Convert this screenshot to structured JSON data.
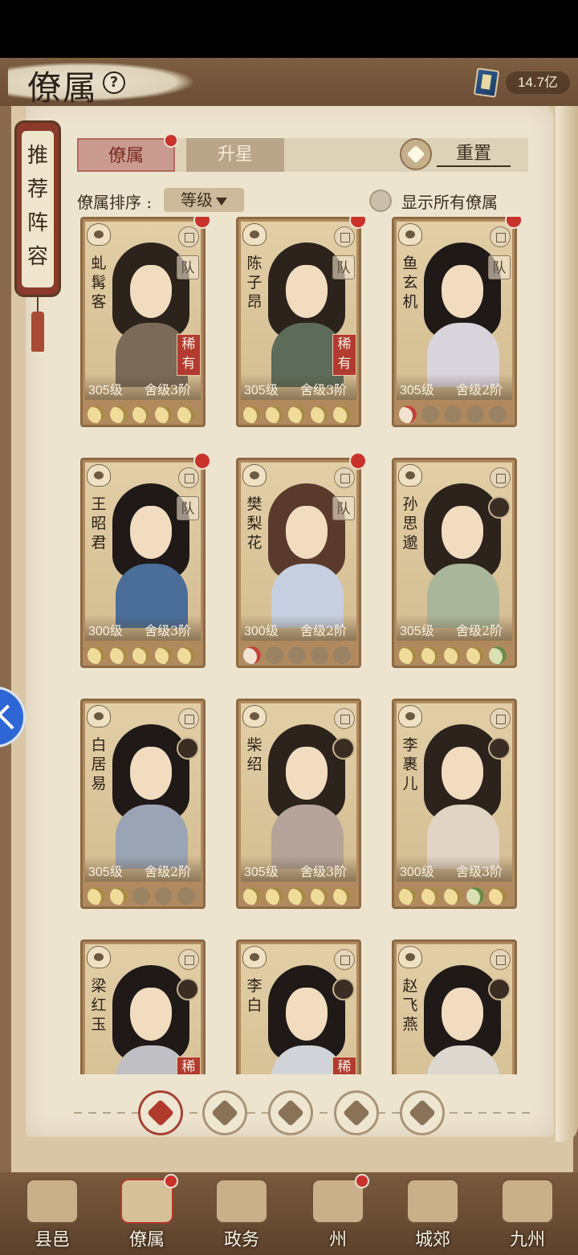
{
  "header": {
    "title": "僚属",
    "currency_value": "14.7亿"
  },
  "recommend": {
    "label": "推荐阵容"
  },
  "tabs": [
    {
      "label": "僚属"
    },
    {
      "label": "升星"
    }
  ],
  "reset": {
    "label": "重置"
  },
  "sort": {
    "label": "僚属排序 :",
    "value": "等级"
  },
  "show_all": {
    "label": "显示所有僚属"
  },
  "cards": [
    {
      "name": "虬髯客",
      "level": "305级",
      "rank": "舍级3阶",
      "rarity": "稀有",
      "team": "队",
      "stars": [
        "lit",
        "lit",
        "lit",
        "lit",
        "lit"
      ],
      "robe": "#7a6a58",
      "hair": "#2b231c"
    },
    {
      "name": "陈子昂",
      "level": "305级",
      "rank": "舍级3阶",
      "rarity": "稀有",
      "team": "队",
      "stars": [
        "lit",
        "lit",
        "lit",
        "lit",
        "lit"
      ],
      "robe": "#5d6b5a",
      "hair": "#2b231c"
    },
    {
      "name": "鱼玄机",
      "level": "305级",
      "rank": "舍级2阶",
      "rarity": "",
      "team": "队",
      "stars": [
        "red",
        "dim",
        "dim",
        "dim",
        "dim"
      ],
      "robe": "#d8d4dc",
      "hair": "#1f1a18"
    },
    {
      "name": "王昭君",
      "level": "300级",
      "rank": "舍级3阶",
      "rarity": "",
      "team": "队",
      "stars": [
        "lit",
        "lit",
        "lit",
        "lit",
        "lit"
      ],
      "robe": "#4a6e98",
      "hair": "#1f1a18"
    },
    {
      "name": "樊梨花",
      "level": "300级",
      "rank": "舍级2阶",
      "rarity": "",
      "team": "队",
      "stars": [
        "red",
        "dim",
        "dim",
        "dim",
        "dim"
      ],
      "robe": "#c6cfe0",
      "hair": "#5a3a2c"
    },
    {
      "name": "孙思邈",
      "level": "305级",
      "rank": "舍级2阶",
      "rarity": "",
      "team": "",
      "stars": [
        "lit",
        "lit",
        "lit",
        "lit",
        "green"
      ],
      "robe": "#aab69a",
      "hair": "#2b231c"
    },
    {
      "name": "白居易",
      "level": "305级",
      "rank": "舍级2阶",
      "rarity": "",
      "team": "",
      "stars": [
        "lit",
        "lit",
        "dim",
        "dim",
        "dim"
      ],
      "robe": "#9aa4b4",
      "hair": "#1f1a18"
    },
    {
      "name": "柴绍",
      "level": "305级",
      "rank": "舍级3阶",
      "rarity": "",
      "team": "",
      "stars": [
        "lit",
        "lit",
        "lit",
        "lit",
        "lit"
      ],
      "robe": "#b4a49a",
      "hair": "#2b231c"
    },
    {
      "name": "李裹儿",
      "level": "300级",
      "rank": "舍级3阶",
      "rarity": "",
      "team": "",
      "stars": [
        "lit",
        "lit",
        "lit",
        "green",
        "lit"
      ],
      "robe": "#e0d4c4",
      "hair": "#2b231c"
    },
    {
      "name": "梁红玉",
      "level": "",
      "rank": "",
      "rarity": "稀",
      "team": "",
      "stars": [],
      "robe": "#c0c0c4",
      "hair": "#1f1a18"
    },
    {
      "name": "李白",
      "level": "",
      "rank": "",
      "rarity": "稀",
      "team": "",
      "stars": [],
      "robe": "#d0d4d8",
      "hair": "#1f1a18"
    },
    {
      "name": "赵飞燕",
      "level": "",
      "rank": "",
      "rarity": "",
      "team": "",
      "stars": [],
      "robe": "#dcd8d0",
      "hair": "#1f1a18"
    }
  ],
  "filters": [
    "all-icon",
    "mountain-icon",
    "gourd-icon",
    "fan-icon",
    "horse-icon"
  ],
  "nav": [
    {
      "label": "县邑"
    },
    {
      "label": "僚属"
    },
    {
      "label": "政务"
    },
    {
      "label": "州"
    },
    {
      "label": "城郊"
    },
    {
      "label": "九州"
    }
  ]
}
